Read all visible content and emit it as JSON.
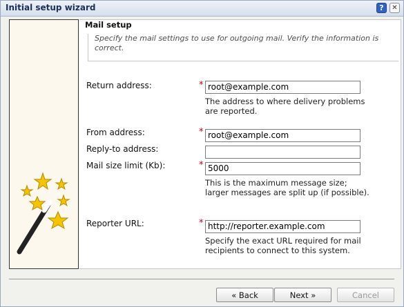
{
  "window": {
    "title": "Initial setup wizard",
    "help_label": "?",
    "close_label": "✕"
  },
  "section": {
    "heading": "Mail setup",
    "description": "Specify the mail settings to use for outgoing mail. Verify the information is correct."
  },
  "fields": {
    "return_address": {
      "label": "Return address:",
      "required": "*",
      "value": "root@example.com",
      "help": "The address to where delivery problems are reported."
    },
    "from_address": {
      "label": "From address:",
      "required": "*",
      "value": "root@example.com"
    },
    "reply_to": {
      "label": "Reply-to address:",
      "value": ""
    },
    "mail_size": {
      "label": "Mail size limit (Kb):",
      "required": "*",
      "value": "5000",
      "help": "This is the maximum message size; larger messages are split up (if possible)."
    },
    "reporter_url": {
      "label": "Reporter URL:",
      "required": "*",
      "value": "http://reporter.example.com",
      "help": "Specify the exact URL required for mail recipients to connect to this system."
    }
  },
  "buttons": {
    "back": "« Back",
    "next": "Next »",
    "cancel": "Cancel"
  },
  "colors": {
    "title_text": "#1c2f55",
    "required_mark": "#cc0000",
    "panel_bg": "#fdf8ee",
    "star": "#f5c400"
  },
  "icons": {
    "sidebar": "magic-wand-icon"
  }
}
